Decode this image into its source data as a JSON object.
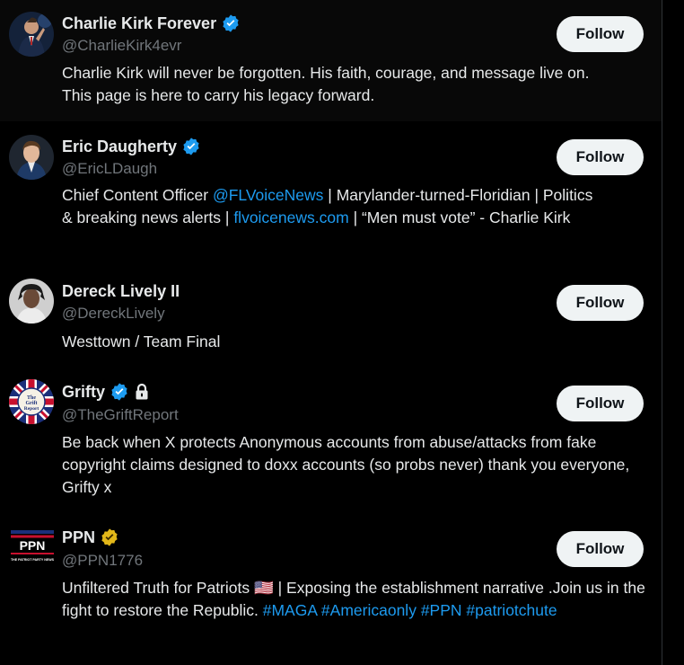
{
  "users": [
    {
      "name": "Charlie Kirk Forever",
      "handle": "@CharlieKirk4evr",
      "verified": "blue",
      "follow_label": "Follow",
      "bio": [
        {
          "text": "Charlie Kirk will never be forgotten. His faith, courage, and message live on.",
          "link": false
        },
        {
          "text": " This page is here to carry his legacy forward.",
          "link": false
        }
      ]
    },
    {
      "name": "Eric Daugherty",
      "handle": "@EricLDaugh",
      "verified": "blue",
      "follow_label": "Follow",
      "bio": [
        {
          "text": "Chief Content Officer ",
          "link": false
        },
        {
          "text": "@FLVoiceNews",
          "link": true
        },
        {
          "text": " | Marylander-turned-Floridian | Politics & breaking news alerts | ",
          "link": false
        },
        {
          "text": "flvoicenews.com",
          "link": true
        },
        {
          "text": " | “Men must vote” - Charlie Kirk",
          "link": false
        }
      ]
    },
    {
      "name": "Dereck Lively II",
      "handle": "@DereckLively",
      "verified": "none",
      "follow_label": "Follow",
      "bio": [
        {
          "text": "Westtown / Team Final",
          "link": false
        }
      ]
    },
    {
      "name": "Grifty",
      "handle": "@TheGriftReport",
      "verified": "blue",
      "protected": true,
      "follow_label": "Follow",
      "avatar_text": "The Grift Report",
      "bio": [
        {
          "text": "Be back when X protects Anonymous accounts from abuse/attacks from fake copyright claims designed to doxx accounts (so probs never) thank you everyone, Grifty x",
          "link": false
        }
      ]
    },
    {
      "name": "PPN",
      "handle": "@PPN1776",
      "verified": "gold",
      "follow_label": "Follow",
      "avatar_text": "PPN",
      "avatar_subtext": "THE PATRIOT PARTY NEWS",
      "bio": [
        {
          "text": "Unfiltered Truth for Patriots 🇺🇸 | Exposing the establishment narrative .Join us in the fight to restore the Republic. ",
          "link": false
        },
        {
          "text": "#MAGA",
          "link": true
        },
        {
          "text": " ",
          "link": false
        },
        {
          "text": "#Americaonly",
          "link": true
        },
        {
          "text": " ",
          "link": false
        },
        {
          "text": "#PPN",
          "link": true
        },
        {
          "text": " ",
          "link": false
        },
        {
          "text": "#patriotchute",
          "link": true
        }
      ]
    }
  ],
  "colors": {
    "background": "#000000",
    "text": "#e7e9ea",
    "secondary": "#71767b",
    "link": "#1d9bf0",
    "verified_blue": "#1d9bf0",
    "verified_gold": "#e2b719",
    "follow_bg": "#eff3f4",
    "follow_text": "#0f1419"
  }
}
